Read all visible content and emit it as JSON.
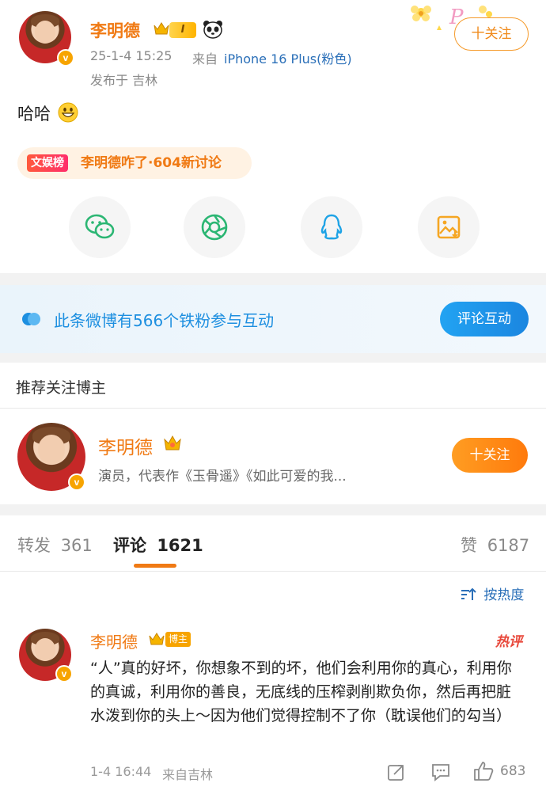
{
  "post": {
    "author": "李明德",
    "level": "I",
    "timestamp": "25-1-4 15:25",
    "source_prefix": "来自",
    "source_device": "iPhone 16 Plus(粉色)",
    "location": "发布于 吉林",
    "content": "哈哈",
    "follow_label": "十关注",
    "hot_tag": "文娱榜",
    "hot_text": "李明德咋了·604新讨论",
    "share_icons": [
      "wechat-icon",
      "moments-icon",
      "qq-icon",
      "save-image-icon"
    ]
  },
  "fans_banner": {
    "text": "此条微博有566个铁粉参与互动",
    "button": "评论互动"
  },
  "recommend": {
    "title": "推荐关注博主",
    "name": "李明德",
    "bio": "演员，代表作《玉骨遥》《如此可爱的我...",
    "follow_label": "十关注"
  },
  "tabs": {
    "repost_label": "转发",
    "repost_count": "361",
    "comment_label": "评论",
    "comment_count": "1621",
    "like_label": "赞",
    "like_count": "6187"
  },
  "sort": {
    "label": "按热度"
  },
  "comment": {
    "author": "李明德",
    "badge": "博主",
    "hot_mark": "热评",
    "text": "“人”真的好坏，你想象不到的坏，他们会利用你的真心，利用你的真诚，利用你的善良，无底线的压榨剥削欺负你，然后再把脏水泼到你的头上～因为他们觉得控制不了你（耽误他们的勾当）",
    "time": "1-4 16:44",
    "location": "来自吉林",
    "likes": "683"
  },
  "colors": {
    "accent": "#f07a14",
    "blue": "#1d8fe0",
    "gray": "#8a8a8a"
  }
}
